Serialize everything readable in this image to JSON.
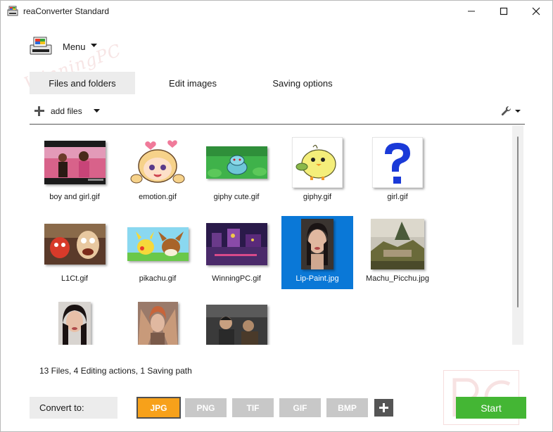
{
  "window": {
    "title": "reaConverter Standard",
    "controls": [
      "minimize",
      "maximize",
      "close"
    ]
  },
  "menu": {
    "label": "Menu"
  },
  "watermark": {
    "text": "WinningPC"
  },
  "tabs": [
    {
      "label": "Files and folders",
      "active": true
    },
    {
      "label": "Edit images",
      "active": false
    },
    {
      "label": "Saving options",
      "active": false
    }
  ],
  "toolbar": {
    "add_files_label": "add files"
  },
  "files": [
    {
      "name": "boy and girl.gif",
      "selected": false
    },
    {
      "name": "emotion.gif",
      "selected": false
    },
    {
      "name": "giphy cute.gif",
      "selected": false
    },
    {
      "name": "giphy.gif",
      "selected": false
    },
    {
      "name": "girl.gif",
      "selected": false
    },
    {
      "name": "L1Ct.gif",
      "selected": false
    },
    {
      "name": "pikachu.gif",
      "selected": false
    },
    {
      "name": "WinningPC.gif",
      "selected": false
    },
    {
      "name": "Lip-Paint.jpg",
      "selected": true
    },
    {
      "name": "Machu_Picchu.jpg",
      "selected": false
    },
    {
      "name": "",
      "selected": false
    },
    {
      "name": "",
      "selected": false
    },
    {
      "name": "",
      "selected": false
    }
  ],
  "status": {
    "text": "13 Files,  4 Editing actions,  1 Saving path"
  },
  "convert": {
    "label": "Convert to:",
    "formats": [
      {
        "label": "JPG",
        "active": true
      },
      {
        "label": "PNG",
        "active": false
      },
      {
        "label": "TIF",
        "active": false
      },
      {
        "label": "GIF",
        "active": false
      },
      {
        "label": "BMP",
        "active": false
      }
    ]
  },
  "start_button": {
    "label": "Start"
  },
  "colors": {
    "accent_orange": "#f7a11a",
    "start_green": "#44b634",
    "selection_blue": "#0a78d7",
    "inactive_format": "#c8c8c8"
  }
}
